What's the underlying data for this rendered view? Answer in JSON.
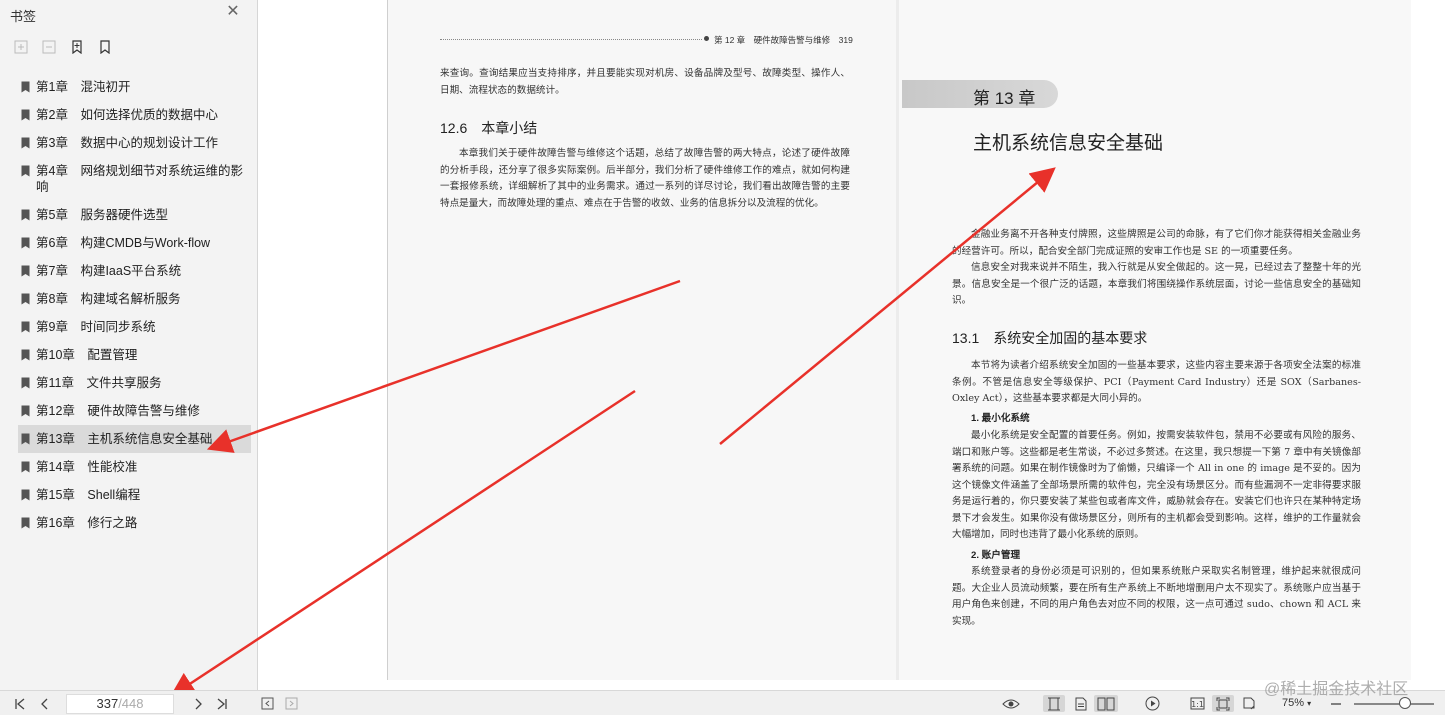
{
  "sidebar": {
    "title": "书签",
    "bookmarks": [
      {
        "label": "第1章　混沌初开"
      },
      {
        "label": "第2章　如何选择优质的数据中心"
      },
      {
        "label": "第3章　数据中心的规划设计工作"
      },
      {
        "label": "第4章　网络规划细节对系统运维的影响"
      },
      {
        "label": "第5章　服务器硬件选型"
      },
      {
        "label": "第6章　构建CMDB与Work-flow"
      },
      {
        "label": "第7章　构建IaaS平台系统"
      },
      {
        "label": "第8章　构建域名解析服务"
      },
      {
        "label": "第9章　时间同步系统"
      },
      {
        "label": "第10章　配置管理"
      },
      {
        "label": "第11章　文件共享服务"
      },
      {
        "label": "第12章　硬件故障告警与维修"
      },
      {
        "label": "第13章　主机系统信息安全基础"
      },
      {
        "label": "第14章　性能校准"
      },
      {
        "label": "第15章　Shell编程"
      },
      {
        "label": "第16章　修行之路"
      }
    ],
    "selected_index": 12
  },
  "left_page": {
    "running_head": "第 12 章　硬件故障告警与维修　319",
    "para1": "来查询。查询结果应当支持排序，并且要能实现对机房、设备品牌及型号、故障类型、操作人、日期、流程状态的数据统计。",
    "section_title": "12.6　本章小结",
    "para2": "本章我们关于硬件故障告警与维修这个话题，总结了故障告警的两大特点，论述了硬件故障的分析手段，还分享了很多实际案例。后半部分，我们分析了硬件维修工作的难点，就如何构建一套报修系统，详细解析了其中的业务需求。通过一系列的详尽讨论，我们看出故障告警的主要特点是量大，而故障处理的重点、难点在于告警的收敛、业务的信息拆分以及流程的优化。"
  },
  "right_page": {
    "chapter_label": "第 13 章",
    "chapter_title": "主机系统信息安全基础",
    "intro1": "金融业务离不开各种支付牌照，这些牌照是公司的命脉，有了它们你才能获得相关金融业务的经营许可。所以，配合安全部门完成证照的安审工作也是 SE 的一项重要任务。",
    "intro2": "信息安全对我来说并不陌生，我入行就是从安全做起的。这一晃，已经过去了整整十年的光景。信息安全是一个很广泛的话题，本章我们将围绕操作系统层面，讨论一些信息安全的基础知识。",
    "section_title": "13.1　系统安全加固的基本要求",
    "section_intro": "本节将为读者介绍系统安全加固的一些基本要求，这些内容主要来源于各项安全法案的标准条例。不管是信息安全等级保护、PCI（Payment Card Industry）还是 SOX（Sarbanes-Oxley Act），这些基本要求都是大同小异的。",
    "item1_title": "1. 最小化系统",
    "item1_text": "最小化系统是安全配置的首要任务。例如，按需安装软件包，禁用不必要或有风险的服务、端口和账户等。这些都是老生常谈，不必过多赘述。在这里，我只想提一下第 7 章中有关镜像部署系统的问题。如果在制作镜像时为了偷懒，只编译一个 All in one 的 image 是不妥的。因为这个镜像文件涵盖了全部场景所需的软件包，完全没有场景区分。而有些漏洞不一定非得要求服务是运行着的，你只要安装了某些包或者库文件，威胁就会存在。安装它们也许只在某种特定场景下才会发生。如果你没有做场景区分，则所有的主机都会受到影响。这样，维护的工作量就会大幅增加，同时也违背了最小化系统的原则。",
    "item2_title": "2. 账户管理",
    "item2_text": "系统登录者的身份必须是可识别的，但如果系统账户采取实名制管理，维护起来就很成问题。大企业人员流动频繁，要在所有生产系统上不断地增删用户太不现实了。系统账户应当基于用户角色来创建，不同的用户角色去对应不同的权限，这一点可通过 sudo、chown 和 ACL 来实现。"
  },
  "toolbar": {
    "current_page": "337",
    "total_pages": "/448",
    "zoom": "75%",
    "zoom_level_percent": 75
  },
  "watermark": "@稀土掘金技术社区",
  "colors": {
    "arrow": "#e8312a",
    "selected_bg": "#dadada",
    "sidebar_bg": "#f3f3f3"
  }
}
